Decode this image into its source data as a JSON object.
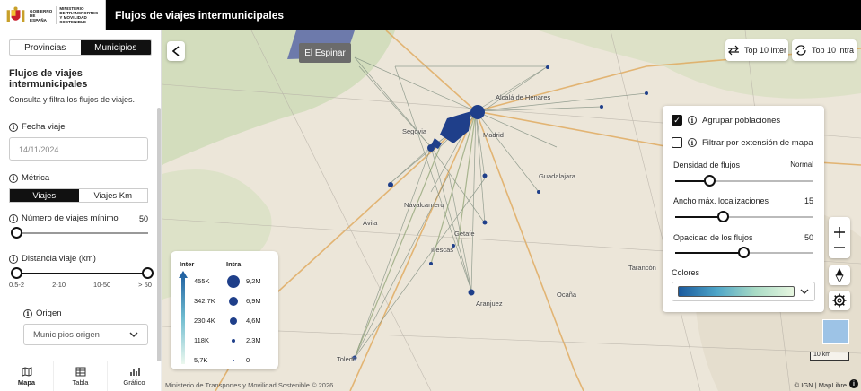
{
  "header": {
    "logo_text": "GOBIERNO DE ESPAÑA · MINISTERIO DE TRANSPORTES Y MOVILIDAD SOSTENIBLE",
    "title": "Flujos de viajes intermunicipales"
  },
  "sidebar": {
    "tabs": [
      {
        "label": "Provincias",
        "active": false
      },
      {
        "label": "Municipios",
        "active": true
      }
    ],
    "title": "Flujos de viajes intermunicipales",
    "subtitle": "Consulta y filtra los flujos de viajes.",
    "date": {
      "label": "Fecha viaje",
      "value": "14/11/2024"
    },
    "metric": {
      "label": "Métrica",
      "options": [
        {
          "label": "Viajes",
          "active": true
        },
        {
          "label": "Viajes Km",
          "active": false
        }
      ]
    },
    "min_trips": {
      "label": "Número de viajes mínimo",
      "value": "50",
      "fraction": 0.0
    },
    "distance": {
      "label": "Distancia viaje (km)",
      "ticks": [
        "0.5-2",
        "2-10",
        "10-50",
        "> 50"
      ],
      "range": [
        0,
        1
      ]
    },
    "origin": {
      "label": "Origen",
      "placeholder": "Municipios origen"
    }
  },
  "bottom_nav": [
    {
      "label": "Mapa",
      "icon": "map-icon",
      "active": true
    },
    {
      "label": "Tabla",
      "icon": "table-icon",
      "active": false
    },
    {
      "label": "Gráfico",
      "icon": "chart-icon",
      "active": false
    }
  ],
  "map": {
    "tooltip": "El Espinar",
    "buttons": {
      "top_inter": "Top 10 inter",
      "top_intra": "Top 10 intra"
    },
    "place_labels": [
      "Segovia",
      "Madrid",
      "Toledo",
      "Alcalá de Henares",
      "Getafe",
      "Aranjuez",
      "Ávila",
      "Guadalajara",
      "Illescas",
      "Ocaña",
      "Tarancón",
      "Navalcarnero"
    ],
    "legend": {
      "inter_label": "Inter",
      "intra_label": "Intra",
      "inter_values": [
        "455K",
        "342,7K",
        "230,4K",
        "118K",
        "5,7K"
      ],
      "intra_values": [
        "9,2M",
        "6,9M",
        "4,6M",
        "2,3M",
        "0"
      ]
    },
    "scale": "10 km",
    "attribution_left": "Ministerio de Transportes y Movilidad Sostenible © 2026",
    "attribution_right": "© IGN | MapLibre"
  },
  "settings_panel": {
    "group_populations": {
      "label": "Agrupar poblaciones",
      "checked": true
    },
    "filter_extent": {
      "label": "Filtrar por extensión de mapa",
      "checked": false
    },
    "density": {
      "label": "Densidad de flujos",
      "value": "Normal",
      "fraction": 0.25
    },
    "max_width": {
      "label": "Ancho máx. localizaciones",
      "value": "15",
      "fraction": 0.35
    },
    "opacity": {
      "label": "Opacidad de los flujos",
      "value": "50",
      "fraction": 0.5
    },
    "colors": {
      "label": "Colores",
      "gradient": [
        "#1a5a9e",
        "#4fa6c8",
        "#a9dbc5",
        "#e7f6e0"
      ]
    }
  }
}
